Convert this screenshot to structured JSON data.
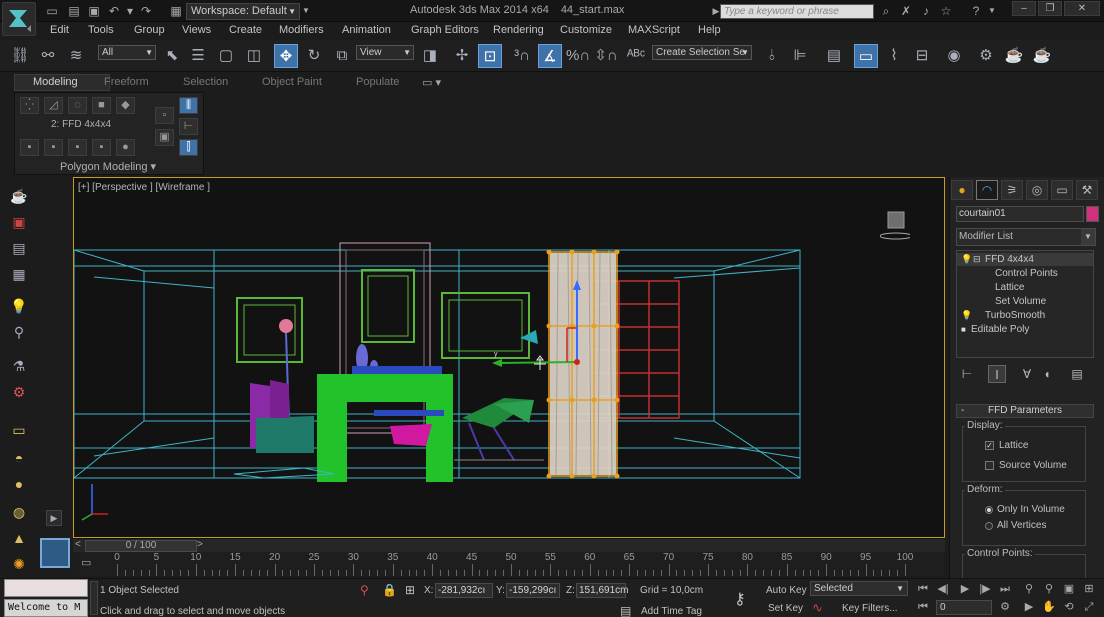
{
  "titlebar": {
    "workspace": "Workspace: Default",
    "app_title": "Autodesk 3ds Max  2014 x64",
    "file_name": "44_start.max",
    "search_placeholder": "Type a keyword or phrase"
  },
  "menu": [
    "Edit",
    "Tools",
    "Group",
    "Views",
    "Create",
    "Modifiers",
    "Animation",
    "Graph Editors",
    "Rendering",
    "Customize",
    "MAXScript",
    "Help"
  ],
  "toolbar": {
    "selection_filter": "All",
    "reference_coord": "View",
    "named_selection": "Create Selection Se"
  },
  "ribbon": {
    "tabs": [
      "Modeling",
      "Freeform",
      "Selection",
      "Object Paint",
      "Populate"
    ],
    "modifier_label": "2: FFD 4x4x4",
    "footer": "Polygon Modeling"
  },
  "viewport": {
    "label": "[+] [Perspective ] [Wireframe ]"
  },
  "timeline": {
    "frame_display": "0 / 100",
    "ticks": [
      0,
      5,
      10,
      15,
      20,
      25,
      30,
      35,
      40,
      45,
      50,
      55,
      60,
      65,
      70,
      75,
      80,
      85,
      90,
      95,
      100
    ]
  },
  "status": {
    "welcome": "Welcome to M",
    "selection": "1 Object Selected",
    "prompt": "Click and drag to select and move objects",
    "x_label": "X:",
    "x_value": "-281,932cı",
    "y_label": "Y:",
    "y_value": "-159,299cı",
    "z_label": "Z:",
    "z_value": "151,691cm",
    "grid": "Grid = 10,0cm",
    "add_time_tag": "Add Time Tag",
    "auto_key": "Auto Key",
    "set_key": "Set Key",
    "key_mode": "Selected",
    "key_filters": "Key Filters...",
    "current_frame": "0"
  },
  "command_panel": {
    "object_name": "courtain01",
    "object_color": "#d0307e",
    "modifier_list": "Modifier List",
    "stack": [
      {
        "label": "FFD 4x4x4",
        "level": 0,
        "selected": true
      },
      {
        "label": "Control Points",
        "level": 1,
        "selected": false
      },
      {
        "label": "Lattice",
        "level": 1,
        "selected": false
      },
      {
        "label": "Set Volume",
        "level": 1,
        "selected": false
      },
      {
        "label": "TurboSmooth",
        "level": 0,
        "selected": false
      },
      {
        "label": "Editable Poly",
        "level": 0,
        "selected": false
      }
    ],
    "rollout_title": "FFD Parameters",
    "display_group": "Display:",
    "lattice_label": "Lattice",
    "source_volume_label": "Source Volume",
    "deform_group": "Deform:",
    "only_in_volume": "Only In Volume",
    "all_vertices": "All Vertices",
    "control_points_group": "Control Points:"
  }
}
